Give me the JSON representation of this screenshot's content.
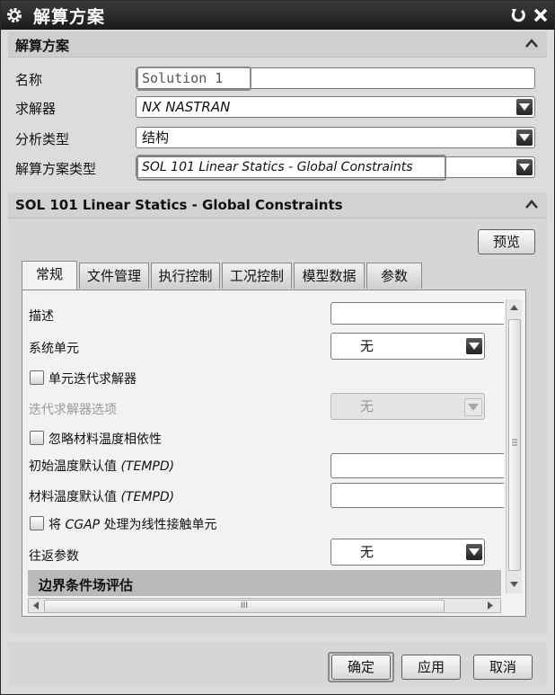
{
  "window": {
    "title": "解算方案",
    "restore_icon": "restore-icon",
    "close_icon": "close-icon"
  },
  "solution_section": {
    "title": "解算方案",
    "fields": {
      "name_label": "名称",
      "name_value": "Solution 1",
      "solver_label": "求解器",
      "solver_value": "NX NASTRAN",
      "analysis_type_label": "分析类型",
      "analysis_type_value": "结构",
      "solution_type_label": "解算方案类型",
      "solution_type_value": "SOL 101 Linear Statics - Global Constraints"
    }
  },
  "sol_section": {
    "title": "SOL 101 Linear Statics - Global Constraints",
    "preview_button": "预览",
    "tabs": [
      "常规",
      "文件管理",
      "执行控制",
      "工况控制",
      "模型数据",
      "参数"
    ],
    "active_tab": "常规",
    "general": {
      "description_label": "描述",
      "description_value": "",
      "system_units_label": "系统单元",
      "system_units_value": "无",
      "element_iterative_label": "单元迭代求解器",
      "iterative_options_label": "迭代求解器选项",
      "iterative_options_value": "无",
      "ignore_temp_label": "忽略材料温度相依性",
      "initial_temp_label_cn": "初始温度默认值",
      "initial_temp_label_en": "(TEMPD)",
      "initial_temp_value": "",
      "material_temp_label_cn": "材料温度默认值",
      "material_temp_label_en": "(TEMPD)",
      "material_temp_value": "",
      "cgap_label_pre": "将",
      "cgap_label_en": "CGAP",
      "cgap_label_post": "处理为线性接触单元",
      "return_params_label": "往返参数",
      "return_params_value": "无",
      "boundary_section": "边界条件场评估",
      "hscroll_thumb": "III"
    }
  },
  "footer": {
    "ok": "确定",
    "apply": "应用",
    "cancel": "取消"
  }
}
